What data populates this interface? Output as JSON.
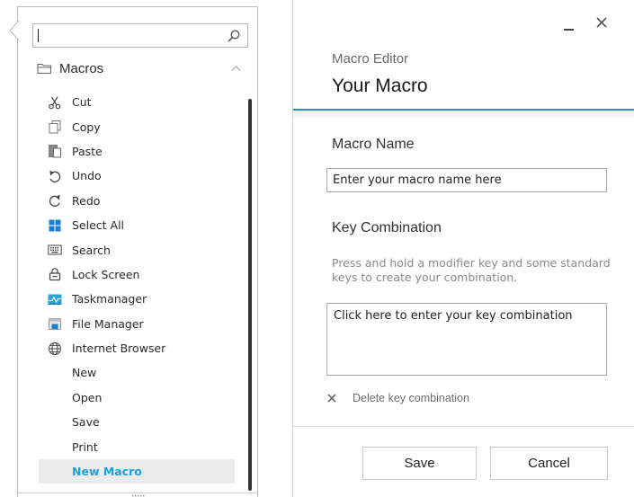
{
  "left_panel": {
    "search": {
      "value": "",
      "placeholder": ""
    },
    "group": {
      "label": "Macros"
    },
    "items": [
      {
        "label": "Cut",
        "icon": "scissors-icon"
      },
      {
        "label": "Copy",
        "icon": "copy-icon"
      },
      {
        "label": "Paste",
        "icon": "paste-icon"
      },
      {
        "label": "Undo",
        "icon": "undo-icon"
      },
      {
        "label": "Redo",
        "icon": "redo-icon"
      },
      {
        "label": "Select All",
        "icon": "select-all-icon"
      },
      {
        "label": "Search",
        "icon": "keyboard-icon"
      },
      {
        "label": "Lock Screen",
        "icon": "lock-icon"
      },
      {
        "label": "Taskmanager",
        "icon": "taskmanager-icon"
      },
      {
        "label": "File Manager",
        "icon": "file-manager-icon"
      },
      {
        "label": "Internet Browser",
        "icon": "globe-icon"
      },
      {
        "label": "New",
        "icon": null
      },
      {
        "label": "Open",
        "icon": null
      },
      {
        "label": "Save",
        "icon": null
      },
      {
        "label": "Print",
        "icon": null
      },
      {
        "label": "New Macro",
        "icon": null,
        "selected": true
      }
    ]
  },
  "dialog": {
    "subtitle": "Macro Editor",
    "title": "Your Macro",
    "macro_name_label": "Macro Name",
    "macro_name_value": "Enter your macro name here",
    "key_combination_label": "Key Combination",
    "help_text": "Press and hold a modifier key and some standard keys to create your combination.",
    "key_combination_value": "Click here to enter your key combination",
    "delete_label": "Delete key combination",
    "save_label": "Save",
    "cancel_label": "Cancel"
  },
  "colors": {
    "accent": "#1ba1e2",
    "header_divider": "#2d95b8",
    "selected_bg": "#ebebeb"
  }
}
